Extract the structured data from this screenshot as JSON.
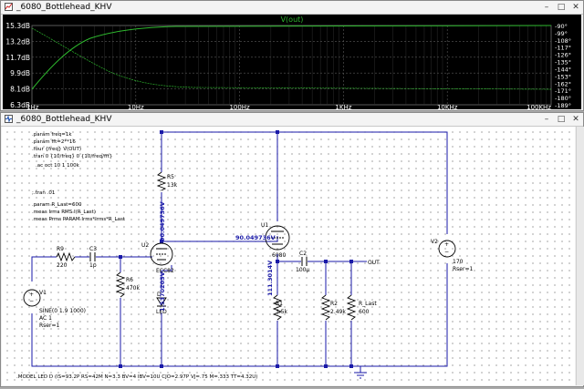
{
  "plot_window": {
    "title": "_6080_Bottlehead_KHV",
    "trace_name": "V(out)",
    "y_ticks_left": [
      "15.3dB",
      "13.2dB",
      "11.7dB",
      "9.9dB",
      "8.1dB",
      "6.3dB"
    ],
    "y_ticks_right": [
      "-90°",
      "-99°",
      "-108°",
      "-117°",
      "-126°",
      "-135°",
      "-144°",
      "-153°",
      "-162°",
      "-171°",
      "-180°",
      "-189°"
    ],
    "x_ticks": [
      "1Hz",
      "10Hz",
      "100Hz",
      "1KHz",
      "10KHz",
      "100KHz"
    ],
    "colors": {
      "background": "#000000",
      "grid": "#5a5a5a",
      "trace": "#2eb82e",
      "axis_text": "#ffffff"
    }
  },
  "schematic_window": {
    "title": "_6080_Bottlehead_KHV",
    "directives": [
      ".param freq=1k",
      ".param fft=2**16",
      ".four {freq} V(OUT)",
      ".tran 0 {10/freq} 0 {10/freq/fft}",
      ".ac oct 10 1 100k",
      ";.tran .01",
      ".param R_Last=600",
      ".meas Irms RMS I(R_Last)",
      ".meas Prms PARAM Irms*Irms*R_Last"
    ],
    "model_line": ".MODEL LED D (IS=93.2P RS=42M N=3.3 BV=4 IBV=10U CJO=2.97P VJ=.75 M=.333 TT=4.32U)",
    "components": {
      "r9": {
        "name": "R9",
        "value": "220"
      },
      "c3": {
        "name": "C3",
        "value": "1p"
      },
      "r6": {
        "name": "R6",
        "value": "470k"
      },
      "r5": {
        "name": "R5",
        "value": "13k"
      },
      "u2": {
        "name": "U2",
        "value": "ECC82"
      },
      "u1": {
        "name": "U1",
        "value": "6080"
      },
      "d": {
        "name": "D",
        "value": "LED"
      },
      "c2": {
        "name": "C2",
        "value": "100µ"
      },
      "r1": {
        "name": "R1",
        "value": "3.5k"
      },
      "r2": {
        "name": "R2",
        "value": "2.49k"
      },
      "r_last": {
        "name": "R_Last",
        "value": "600"
      },
      "v1": {
        "name": "V1",
        "lines": [
          "SINE(0 1.9 1000)",
          "AC 1",
          "Rser=1"
        ]
      },
      "v2": {
        "name": "V2",
        "lines": [
          "170",
          "Rser=1"
        ]
      }
    },
    "node_voltages": {
      "u2_plate": "90.049736V",
      "u1_grid": "90.049736V",
      "u2_cathode": "1.5370203V",
      "u1_cathode": "111.3014V"
    },
    "net_label_out": "OUT"
  }
}
